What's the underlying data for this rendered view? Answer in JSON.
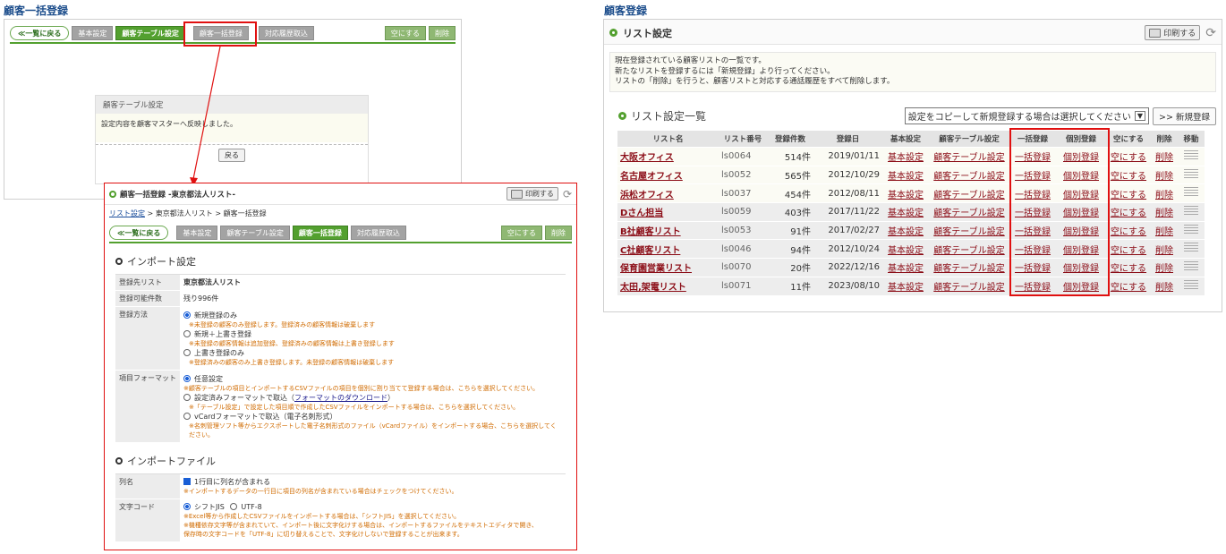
{
  "left": {
    "page_title": "顧客一括登録",
    "top_window": {
      "tabs": [
        {
          "label": "≪一覧に戻る",
          "style": "back"
        },
        {
          "label": "基本設定",
          "style": "gray"
        },
        {
          "label": "顧客テーブル設定",
          "style": "green"
        },
        {
          "label": "顧客一括登録",
          "style": "gray"
        },
        {
          "label": "対応履歴取込",
          "style": "gray"
        }
      ],
      "right_tabs": [
        "空にする",
        "削除"
      ],
      "dialog": {
        "title": "顧客テーブル設定",
        "message": "設定内容を顧客マスターへ反映しました。",
        "button": "戻る"
      }
    },
    "import_window": {
      "title": "顧客一括登録 -東京都法人リスト-",
      "print_label": "印刷する",
      "breadcrumb": [
        "リスト設定",
        " > ",
        "東京都法人リスト",
        " > ",
        "顧客一括登録"
      ],
      "tabs": [
        {
          "label": "≪一覧に戻る",
          "style": "back"
        },
        {
          "label": "基本設定",
          "style": "gray"
        },
        {
          "label": "顧客テーブル設定",
          "style": "gray"
        },
        {
          "label": "顧客一括登録",
          "style": "green"
        },
        {
          "label": "対応履歴取込",
          "style": "gray"
        }
      ],
      "right_tabs": [
        "空にする",
        "削除"
      ],
      "import_settings": {
        "heading": "インポート設定",
        "target_list_label": "登録先リスト",
        "target_list_value": "東京都法人リスト",
        "available_label": "登録可能件数",
        "available_value": "残り996件",
        "method_label": "登録方法",
        "methods": [
          {
            "label": "新規登録のみ",
            "note": "※未登録の顧客のみ登録します。登録済みの顧客情報は破棄します",
            "selected": true
          },
          {
            "label": "新規＋上書き登録",
            "note": "※未登録の顧客情報は追加登録、登録済みの顧客情報は上書き登録します",
            "selected": false
          },
          {
            "label": "上書き登録のみ",
            "note": "※登録済みの顧客のみ上書き登録します。未登録の顧客情報は破棄します",
            "selected": false
          }
        ],
        "format_label": "項目フォーマット",
        "formats": [
          {
            "label": "任意設定",
            "note": "※顧客テーブルの項目とインポートするCSVファイルの項目を個別に割り当てて登録する場合は、こちらを選択してください。",
            "selected": true
          },
          {
            "label_prefix": "設定済みフォーマットで取込（",
            "label_link": "フォーマットのダウンロード",
            "label_suffix": "）",
            "note": "※「テーブル設定」で設定した項目順で作成したCSVファイルをインポートする場合は、こちらを選択してください。",
            "selected": false
          },
          {
            "label": "vCardフォーマットで取込（電子名刺形式）",
            "note": "※名刺管理ソフト等からエクスポートした電子名刺形式のファイル（vCardファイル）をインポートする場合、こちらを選択してください。",
            "selected": false
          }
        ]
      },
      "import_file": {
        "heading": "インポートファイル",
        "column_label": "列名",
        "column_check": "1行目に列名が含まれる",
        "column_note": "※インポートするデータの一行目に項目の列名が含まれている場合はチェックをつけてください。",
        "encoding_label": "文字コード",
        "encoding_options": [
          "シフトJIS",
          "UTF-8"
        ],
        "encoding_notes": [
          "※Excel等から作成したCSVファイルをインポートする場合は、「シフトJIS」を選択してください。",
          "※機種依存文字等が含まれていて、インポート後に文字化けする場合は、インポートするファイルをテキストエディタで開き、",
          "保存時の文字コードを「UTF-8」に切り替えることで、文字化けしないで登録することが出来ます。"
        ]
      }
    }
  },
  "right": {
    "page_title": "顧客登録",
    "panel_title": "リスト設定",
    "print_label": "印刷する",
    "description": [
      "現在登録されている顧客リストの一覧です。",
      "新たなリストを登録するには「新規登録」より行ってください。",
      "リストの「削除」を行うと、顧客リストと対応する通話履歴をすべて削除します。"
    ],
    "list_heading": "リスト設定一覧",
    "copy_select": "設定をコピーして新規登録する場合は選択してください",
    "new_button": ">> 新規登録",
    "columns": [
      "リスト名",
      "リスト番号",
      "登録件数",
      "登録日",
      "基本設定",
      "顧客テーブル設定",
      "一括登録",
      "個別登録",
      "空にする",
      "削除",
      "移動"
    ],
    "rows": [
      {
        "name": "大阪オフィス",
        "no": "ls0064",
        "count": "514件",
        "date": "2019/01/11"
      },
      {
        "name": "名古屋オフィス",
        "no": "ls0052",
        "count": "565件",
        "date": "2012/10/29"
      },
      {
        "name": "浜松オフィス",
        "no": "ls0037",
        "count": "454件",
        "date": "2012/08/11"
      },
      {
        "name": "Dさん担当",
        "no": "ls0059",
        "count": "403件",
        "date": "2017/11/22"
      },
      {
        "name": "B社顧客リスト",
        "no": "ls0053",
        "count": "91件",
        "date": "2017/02/27"
      },
      {
        "name": "C社顧客リスト",
        "no": "ls0046",
        "count": "94件",
        "date": "2012/10/24"
      },
      {
        "name": "保育園営業リスト",
        "no": "ls0070",
        "count": "20件",
        "date": "2022/12/16"
      },
      {
        "name": "太田,架電リスト",
        "no": "ls0071",
        "count": "11件",
        "date": "2023/08/10"
      }
    ],
    "row_links": {
      "basic": "基本設定",
      "table": "顧客テーブル設定",
      "bulk": "一括登録",
      "single": "個別登録",
      "empty": "空にする",
      "delete": "削除"
    }
  },
  "colors": {
    "accent_green": "#53a02f",
    "highlight_red": "#e01010",
    "link": "#8b0c16",
    "title_blue": "#1d4e8c"
  }
}
